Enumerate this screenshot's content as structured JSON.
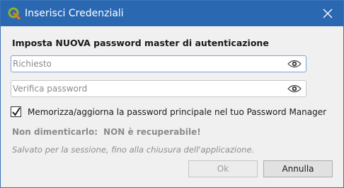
{
  "window": {
    "title": "Inserisci Credenziali",
    "icon": "qgis-logo-icon",
    "colors": {
      "titlebar": "#2b68b2",
      "accent": "#7aa3d9",
      "disabled_text": "#8c8c8c"
    }
  },
  "form": {
    "heading": "Imposta NUOVA password master di autenticazione",
    "password": {
      "placeholder": "Richiesto",
      "value": ""
    },
    "verify": {
      "placeholder": "Verifica password",
      "value": ""
    },
    "store_checkbox": {
      "label": "Memorizza/aggiorna la password principale nel tuo Password Manager",
      "checked": true
    },
    "warning_1": "Non dimenticarlo:",
    "warning_2": "NON è recuperabile!",
    "note": "Salvato per la sessione, fino alla chiusura dell'applicazione."
  },
  "buttons": {
    "ok": "Ok",
    "cancel": "Annulla"
  }
}
